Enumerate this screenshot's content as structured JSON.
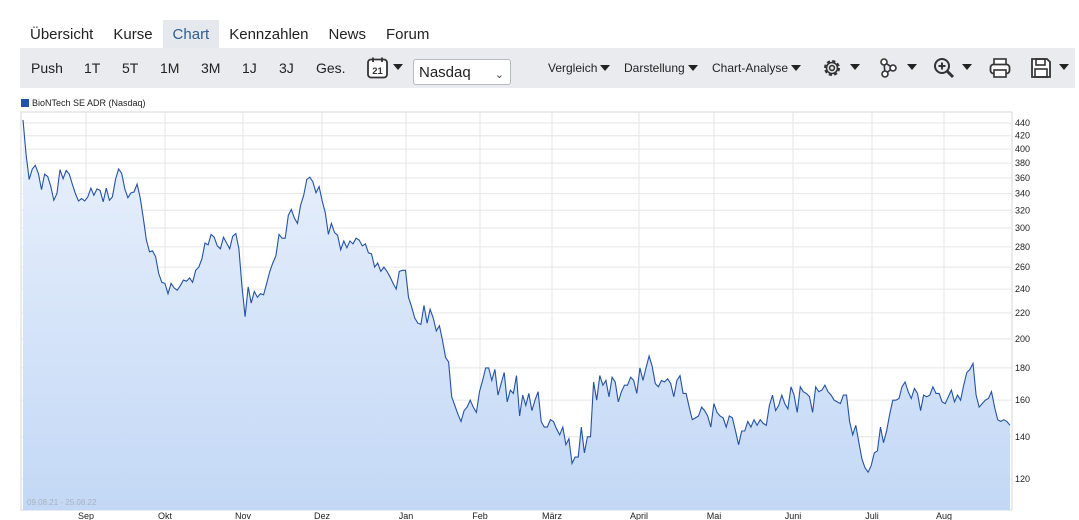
{
  "nav": {
    "tabs": [
      {
        "label": "Übersicht"
      },
      {
        "label": "Kurse"
      },
      {
        "label": "Chart",
        "active": true
      },
      {
        "label": "Kennzahlen"
      },
      {
        "label": "News"
      },
      {
        "label": "Forum"
      }
    ]
  },
  "toolbar": {
    "ranges": [
      "Push",
      "1T",
      "5T",
      "1M",
      "3M",
      "1J",
      "3J",
      "Ges."
    ],
    "calendar_day": "21",
    "exchange": "Nasdaq",
    "menus": [
      "Vergleich",
      "Darstellung",
      "Chart-Analyse"
    ],
    "icons": [
      "gear-icon",
      "network-icon",
      "zoom-in-icon",
      "print-icon",
      "save-icon"
    ]
  },
  "chart_data": {
    "type": "line",
    "series": [
      {
        "name": "BioNTech SE ADR (Nasdaq)",
        "color": "#2452a4",
        "values": [
          445,
          392,
          358,
          372,
          377,
          366,
          345,
          365,
          362,
          349,
          332,
          340,
          371,
          359,
          370,
          365,
          352,
          340,
          331,
          334,
          331,
          336,
          347,
          338,
          346,
          344,
          330,
          347,
          332,
          336,
          358,
          372,
          366,
          346,
          335,
          341,
          342,
          352,
          335,
          311,
          287,
          275,
          276,
          270,
          254,
          246,
          245,
          236,
          245,
          241,
          239,
          243,
          248,
          247,
          250,
          246,
          257,
          260,
          268,
          284,
          282,
          293,
          290,
          281,
          278,
          290,
          284,
          278,
          291,
          294,
          278,
          242,
          217,
          242,
          228,
          238,
          233,
          236,
          235,
          245,
          256,
          264,
          271,
          293,
          289,
          289,
          314,
          321,
          311,
          305,
          326,
          338,
          358,
          361,
          355,
          341,
          349,
          331,
          317,
          293,
          305,
          295,
          292,
          277,
          286,
          279,
          286,
          283,
          289,
          287,
          281,
          283,
          274,
          273,
          260,
          264,
          256,
          260,
          256,
          251,
          245,
          240,
          256,
          257,
          257,
          233,
          225,
          216,
          212,
          211,
          226,
          212,
          223,
          216,
          206,
          210,
          199,
          187,
          184,
          162,
          157,
          152,
          148,
          154,
          156,
          160,
          156,
          153,
          165,
          172,
          180,
          180,
          172,
          179,
          163,
          170,
          177,
          159,
          166,
          164,
          175,
          151,
          163,
          157,
          164,
          154,
          160,
          165,
          148,
          145,
          145,
          149,
          148,
          144,
          141,
          145,
          136,
          139,
          127,
          130,
          130,
          145,
          132,
          140,
          140,
          171,
          160,
          175,
          169,
          172,
          162,
          174,
          171,
          159,
          165,
          169,
          169,
          174,
          172,
          164,
          180,
          172,
          180,
          188,
          181,
          170,
          168,
          172,
          171,
          173,
          170,
          162,
          172,
          175,
          164,
          164,
          156,
          149,
          150,
          151,
          156,
          154,
          151,
          145,
          158,
          153,
          151,
          150,
          145,
          151,
          150,
          143,
          136,
          143,
          143,
          148,
          145,
          149,
          146,
          149,
          147,
          146,
          157,
          163,
          154,
          157,
          163,
          158,
          155,
          168,
          163,
          153,
          168,
          165,
          164,
          162,
          153,
          168,
          165,
          166,
          169,
          165,
          163,
          160,
          159,
          158,
          163,
          163,
          148,
          141,
          146,
          137,
          129,
          125,
          123,
          126,
          132,
          133,
          145,
          137,
          143,
          152,
          160,
          160,
          161,
          168,
          171,
          165,
          161,
          167,
          164,
          154,
          163,
          162,
          163,
          168,
          164,
          164,
          159,
          158,
          162,
          166,
          159,
          163,
          160,
          169,
          177,
          179,
          183,
          163,
          156,
          158,
          160,
          161,
          165,
          156,
          149,
          148,
          149,
          148,
          146
        ]
      }
    ],
    "x_months": [
      "Sep",
      "Okt",
      "Nov",
      "Dez",
      "Jan",
      "Feb",
      "März",
      "April",
      "Mai",
      "Juni",
      "Juli",
      "Aug"
    ],
    "y_ticks": [
      120,
      140,
      160,
      180,
      200,
      220,
      240,
      260,
      280,
      300,
      320,
      340,
      360,
      380,
      400,
      420,
      440
    ],
    "ylim": [
      110,
      455
    ],
    "y_scale": "log",
    "period_label": "09.08.21 - 25.08.22",
    "grid": true,
    "legend": "top-left",
    "fill": "area-gradient"
  }
}
